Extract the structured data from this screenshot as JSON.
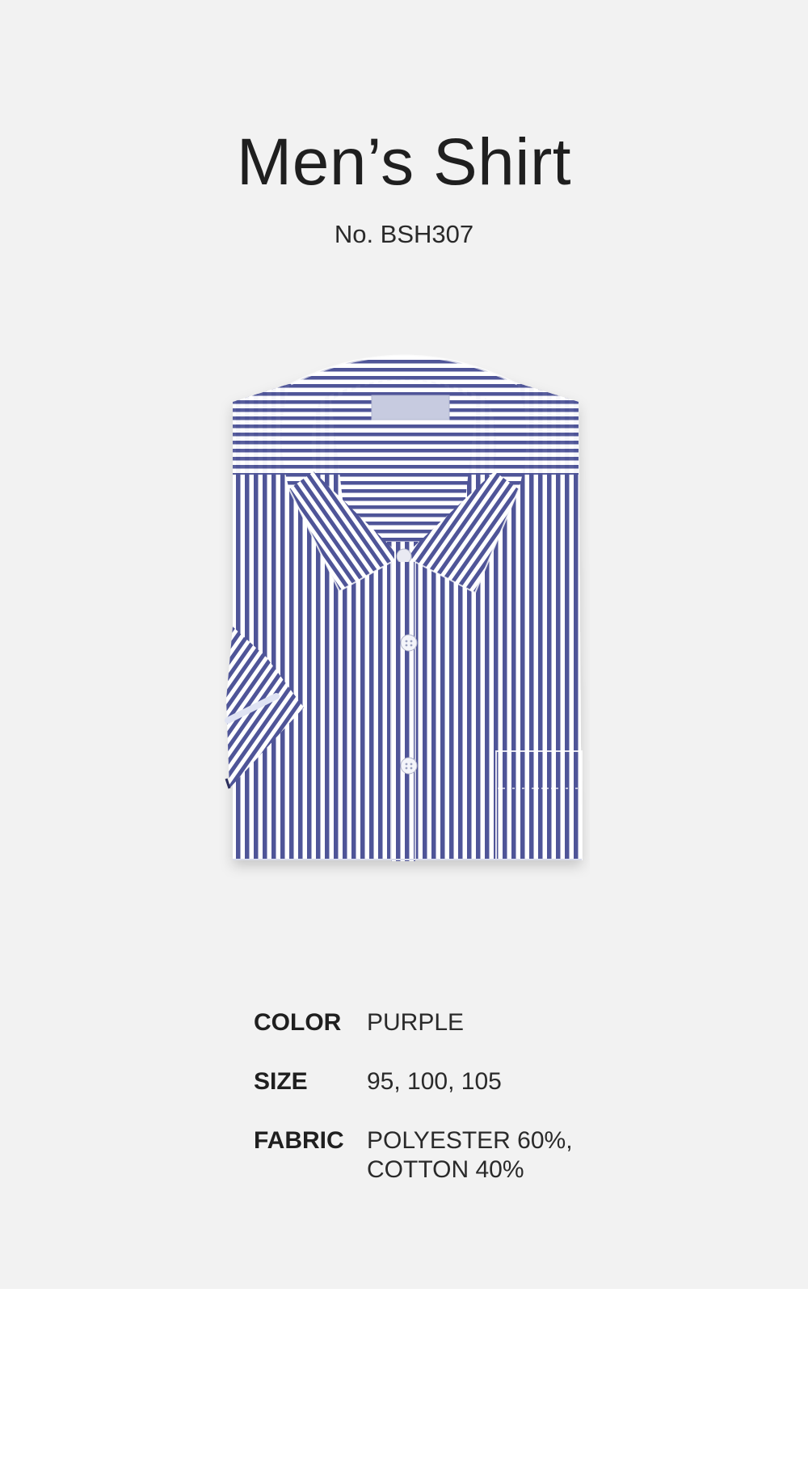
{
  "product": {
    "title": "Men’s Shirt",
    "number": "No. BSH307",
    "image_icon": "striped-short-sleeve-shirt-icon"
  },
  "specs": [
    {
      "label": "COLOR",
      "value": "PURPLE"
    },
    {
      "label": "SIZE",
      "value": "95, 100, 105"
    },
    {
      "label": "FABRIC",
      "value": "POLYESTER 60%,\nCOTTON 40%"
    }
  ],
  "colors": {
    "background": "#f2f2f2",
    "page": "#ffffff",
    "stripe": "#4f5598",
    "text": "#222222"
  }
}
